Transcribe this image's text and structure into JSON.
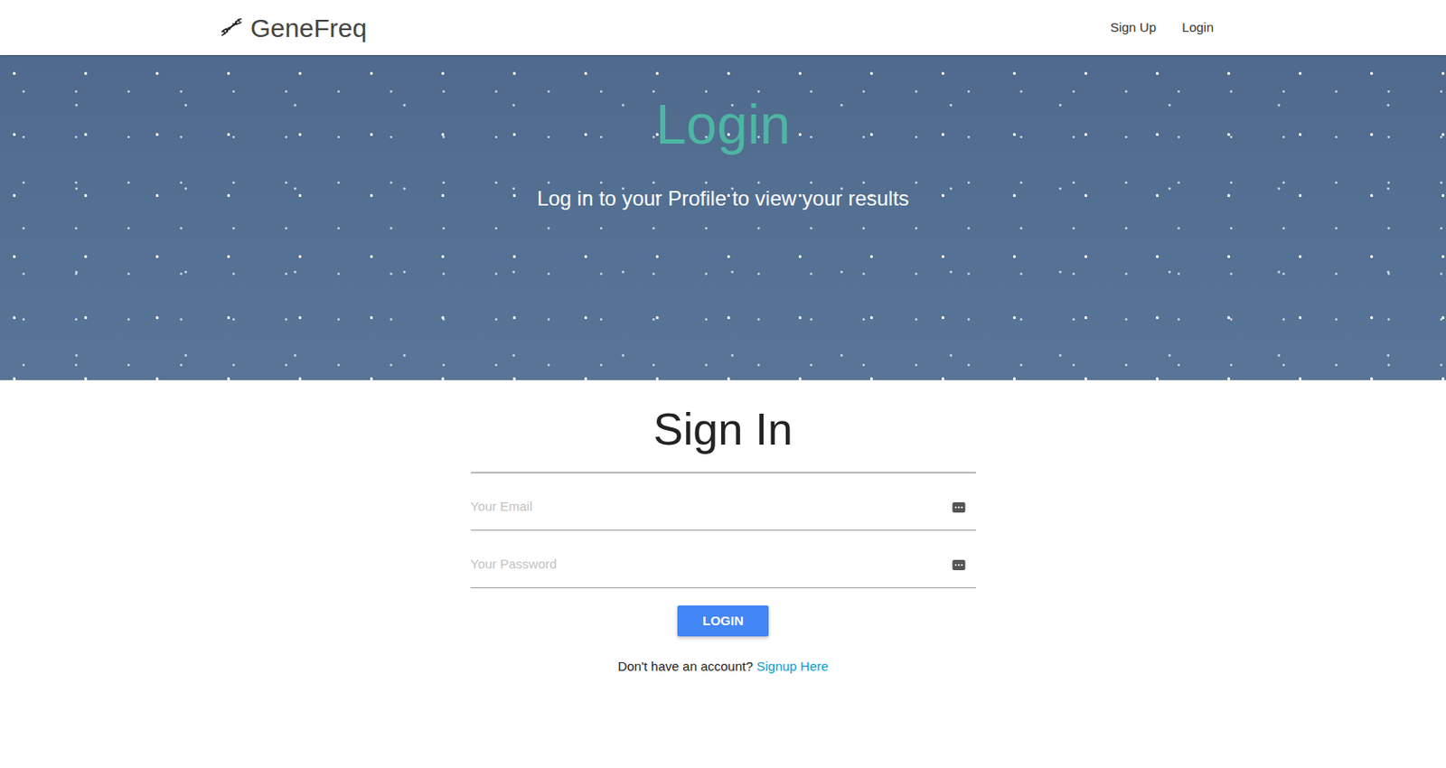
{
  "brand": {
    "name": "GeneFreq"
  },
  "nav": [
    "Sign Up",
    "Login"
  ],
  "hero": {
    "title": "Login",
    "subtitle": "Log in to your Profile to view your results"
  },
  "form": {
    "heading": "Sign In",
    "fields": [
      {
        "placeholder": "Your Email"
      },
      {
        "placeholder": "Your Password"
      }
    ],
    "button": "LOGIN",
    "footer": {
      "text": "Don't have an account?",
      "link": "Signup Here"
    }
  }
}
